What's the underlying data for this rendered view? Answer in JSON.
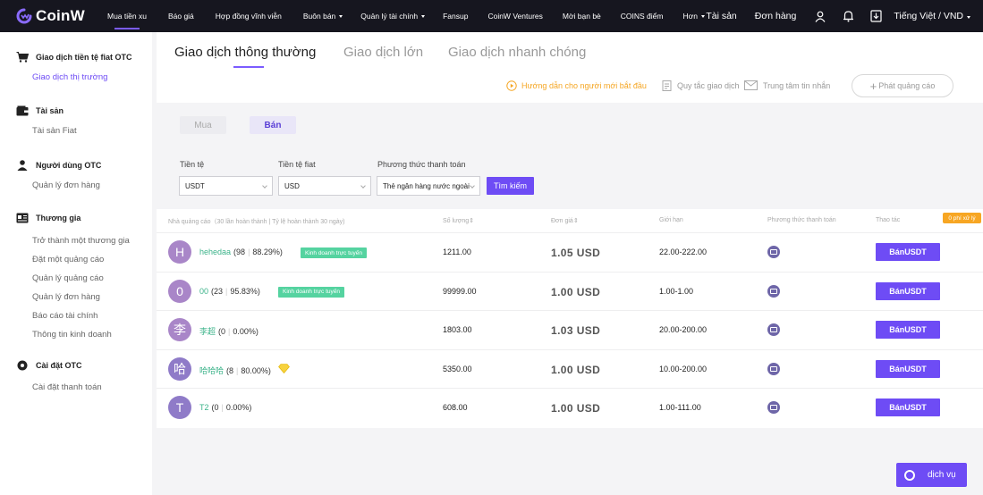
{
  "brand": {
    "name": "CoinW",
    "accent": "#6e4cf5",
    "nav_bg": "#16161f"
  },
  "nav": {
    "items": [
      {
        "label": "Mua tiền xu",
        "active": true
      },
      {
        "label": "Báo giá"
      },
      {
        "label": "Hợp đồng vĩnh viễn"
      },
      {
        "label": "Buôn bán",
        "dropdown": true
      },
      {
        "label": "Quản lý tài chính",
        "dropdown": true
      },
      {
        "label": "Fansup"
      },
      {
        "label": "CoinW Ventures"
      },
      {
        "label": "Mời bạn bè"
      },
      {
        "label": "COINS điểm"
      },
      {
        "label": "Hơn",
        "dropdown": true
      }
    ],
    "assets": "Tài sản",
    "orders": "Đơn hàng",
    "language": "Tiếng Việt / VND"
  },
  "sidebar": {
    "groups": [
      {
        "title": "Giao dịch tiền tệ fiat OTC",
        "icon": "cart-icon",
        "items": [
          {
            "label": "Giao dịch thị trường",
            "active": true
          }
        ]
      },
      {
        "title": "Tài sản",
        "icon": "wallet-icon",
        "items": [
          {
            "label": "Tài sản Fiat"
          }
        ]
      },
      {
        "title": "Người dùng OTC",
        "icon": "user-icon",
        "items": [
          {
            "label": "Quản lý đơn hàng"
          }
        ]
      },
      {
        "title": "Thương gia",
        "icon": "merchant-icon",
        "items": [
          {
            "label": "Trở thành một thương gia"
          },
          {
            "label": "Đặt một quảng cáo"
          },
          {
            "label": "Quản lý quảng cáo"
          },
          {
            "label": "Quản lý đơn hàng"
          },
          {
            "label": "Báo cáo tài chính"
          },
          {
            "label": "Thông tin kinh doanh"
          }
        ]
      },
      {
        "title": "Cài đặt OTC",
        "icon": "settings-icon",
        "items": [
          {
            "label": "Cài đặt thanh toán"
          }
        ]
      }
    ]
  },
  "tabs": [
    {
      "label": "Giao dịch thông thường",
      "active": true
    },
    {
      "label": "Giao dịch lớn"
    },
    {
      "label": "Giao dịch nhanh chóng"
    }
  ],
  "tools": {
    "beginner_guide": "Hướng dẫn cho người mới bắt đầu",
    "trading_rules": "Quy tắc giao dịch",
    "message_center": "Trung tâm tin nhắn",
    "post_ad": "Phát quảng cáo"
  },
  "trade_side": {
    "buy": "Mua",
    "sell": "Bán",
    "selected": "sell"
  },
  "filters": {
    "currency": {
      "label": "Tiền tệ",
      "value": "USDT"
    },
    "fiat": {
      "label": "Tiền tệ fiat",
      "value": "USD"
    },
    "payment": {
      "label": "Phương thức thanh toán",
      "value": "Thẻ ngân hàng nước ngoài"
    },
    "search": "Tìm kiếm"
  },
  "table": {
    "headers": {
      "advertiser": "Nhà quảng cáo（30 lần hoàn thành | Tỷ lệ hoàn thành 30 ngày)",
      "quantity": "Số lượng",
      "price": "Đơn giá",
      "limit": "Giới hạn",
      "payment": "Phương thức thanh toán",
      "action": "Thao tác"
    },
    "fee_badge": "0 phí xử lý",
    "online_label": "Kinh doanh trực tuyến",
    "rows": [
      {
        "avatar": "H",
        "avatar_color": "#a986c8",
        "name": "hehedaa",
        "trades": "(98",
        "rate": "88.29%)",
        "online": true,
        "quantity": "1211.00",
        "price": "1.05 USD",
        "limit": "22.00-222.00",
        "action": "BánUSDT"
      },
      {
        "avatar": "0",
        "avatar_color": "#a986c8",
        "name": "00",
        "trades": "(23",
        "rate": "95.83%)",
        "online": true,
        "quantity": "99999.00",
        "price": "1.00 USD",
        "limit": "1.00-1.00",
        "action": "BánUSDT"
      },
      {
        "avatar": "李",
        "avatar_color": "#a986c8",
        "name": "李超",
        "trades": "(0",
        "rate": "0.00%)",
        "online": false,
        "quantity": "1803.00",
        "price": "1.03 USD",
        "limit": "20.00-200.00",
        "action": "BánUSDT"
      },
      {
        "avatar": "哈",
        "avatar_color": "#8f7bc8",
        "name": "哈哈哈",
        "trades": "(8",
        "rate": "80.00%)",
        "online": false,
        "diamond": true,
        "quantity": "5350.00",
        "price": "1.00 USD",
        "limit": "10.00-200.00",
        "action": "BánUSDT"
      },
      {
        "avatar": "T",
        "avatar_color": "#8f7bc8",
        "name": "T2",
        "trades": "(0",
        "rate": "0.00%)",
        "online": false,
        "quantity": "608.00",
        "price": "1.00 USD",
        "limit": "1.00-111.00",
        "action": "BánUSDT"
      }
    ]
  },
  "service_button": "dịch vụ"
}
